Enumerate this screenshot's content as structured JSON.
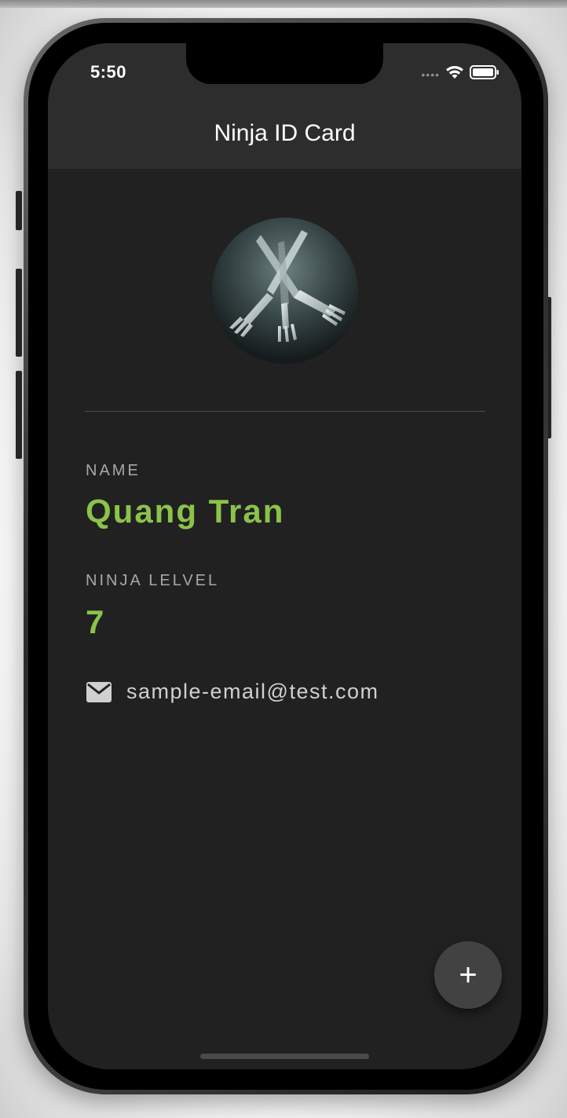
{
  "status_bar": {
    "time": "5:50"
  },
  "app_bar": {
    "title": "Ninja ID Card"
  },
  "profile": {
    "name_label": "NAME",
    "name_value": "Quang Tran",
    "level_label": "NINJA LELVEL",
    "level_value": "7",
    "email": "sample-email@test.com"
  },
  "fab": {
    "label": "+"
  },
  "colors": {
    "background": "#212121",
    "app_bar": "#2d2d2d",
    "accent": "#8bc34a",
    "label": "#a8a8a8",
    "fab": "#424242"
  },
  "icons": {
    "email": "mail-icon",
    "wifi": "wifi-icon",
    "battery": "battery-icon"
  }
}
